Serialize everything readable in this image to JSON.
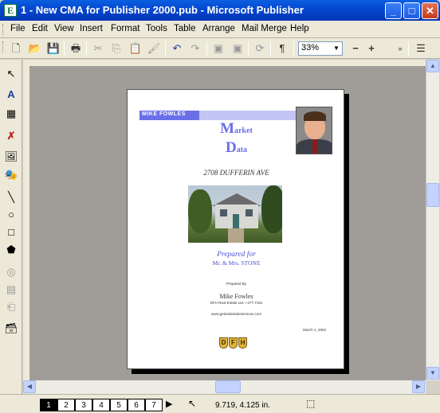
{
  "window": {
    "title": "1 - New CMA for Publisher 2000.pub - Microsoft Publisher",
    "icon_letter": "E",
    "controls": [
      "minimize-icon",
      "maximize-icon",
      "close-icon"
    ]
  },
  "menubar": {
    "items": [
      {
        "label": "File"
      },
      {
        "label": "Edit"
      },
      {
        "label": "View"
      },
      {
        "label": "Insert"
      },
      {
        "label": "Format"
      },
      {
        "label": "Tools"
      },
      {
        "label": "Table"
      },
      {
        "label": "Arrange"
      },
      {
        "label": "Mail Merge"
      },
      {
        "label": "Help"
      }
    ]
  },
  "toolbar": {
    "zoom_value": "33%",
    "zoom_out_label": "−",
    "zoom_in_label": "+",
    "paragraph_label": "¶",
    "icons": [
      "new-icon",
      "open-icon",
      "save-icon",
      "print-icon",
      "cut-icon",
      "copy-icon",
      "paste-icon",
      "format-painter-icon",
      "undo-icon",
      "redo-icon",
      "bring-front-icon",
      "send-back-icon",
      "rotate-icon",
      "paragraph-icon"
    ]
  },
  "objects_toolbar": {
    "tools": [
      "pointer-icon",
      "text-frame-icon",
      "table-frame-icon",
      "wordart-icon",
      "picture-frame-icon",
      "clip-gallery-icon",
      "line-icon",
      "oval-icon",
      "rectangle-icon",
      "custom-shape-icon",
      "hotspot-icon",
      "form-control-icon",
      "html-fragment-icon",
      "design-gallery-icon"
    ]
  },
  "document": {
    "agent_banner": "MIKE FOWLES",
    "title_line1_cap": "M",
    "title_line1_rest": "arket",
    "title_line2_cap": "D",
    "title_line2_rest": "ata",
    "address": "2708 DUFFERIN AVE",
    "prepared_for": "Prepared for",
    "client": "Mr. & Mrs. STONE",
    "prepared_by": "Prepared By",
    "agent_name": "Mike Fowles",
    "company": "DFH Real Estate Ltd. • 477-7191",
    "website": "www.getrealestateservices.com",
    "date": "March 1, 2002",
    "logo_letters": [
      "D",
      "F",
      "H"
    ]
  },
  "statusbar": {
    "pages": [
      "1",
      "2",
      "3",
      "4",
      "5",
      "6",
      "7"
    ],
    "active_page": "1",
    "coordinates": "9.719, 4.125 in."
  }
}
